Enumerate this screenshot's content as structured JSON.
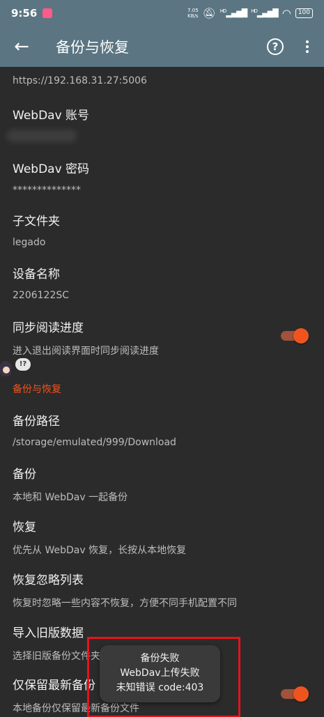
{
  "status_bar": {
    "time": "9:56",
    "net_speed_value": "7.05",
    "net_speed_unit": "KB/s",
    "signal1": "HD",
    "signal2": "HD",
    "battery": "100"
  },
  "app_bar": {
    "title": "备份与恢复",
    "back_icon": "arrow-left-icon",
    "help_icon": "help-circle-icon",
    "more_icon": "more-vert-icon"
  },
  "webdav_url": "https://192.168.31.27:5006",
  "prefs": {
    "account": {
      "title": "WebDav 账号"
    },
    "password": {
      "title": "WebDav 密码",
      "summary": "**************"
    },
    "subfolder": {
      "title": "子文件夹",
      "summary": "legado"
    },
    "device": {
      "title": "设备名称",
      "summary": "2206122SC"
    },
    "sync_progress": {
      "title": "同步阅读进度",
      "summary": "进入退出阅读界面时同步阅读进度",
      "enabled": true
    },
    "category": "备份与恢复",
    "mascot_bubble": "!?",
    "backup_path": {
      "title": "备份路径",
      "summary": "/storage/emulated/999/Download"
    },
    "backup": {
      "title": "备份",
      "summary": "本地和 WebDav 一起备份"
    },
    "restore": {
      "title": "恢复",
      "summary": "优先从 WebDav 恢复，长按从本地恢复"
    },
    "restore_ignore": {
      "title": "恢复忽略列表",
      "summary": "恢复时忽略一些内容不恢复，方便不同手机配置不同"
    },
    "import_old": {
      "title": "导入旧版数据",
      "summary": "选择旧版备份文件夹"
    },
    "keep_latest": {
      "title": "仅保留最新备份",
      "summary": "本地备份仅保留最新备份文件",
      "enabled": true
    }
  },
  "toast": {
    "line1": "备份失败",
    "line2": "WebDav上传失败",
    "line3": "未知错误  code:403"
  },
  "colors": {
    "toolbar": "#5b7682",
    "background": "#2b2b2b",
    "accent": "#f0541e",
    "highlight": "#e8121b"
  }
}
